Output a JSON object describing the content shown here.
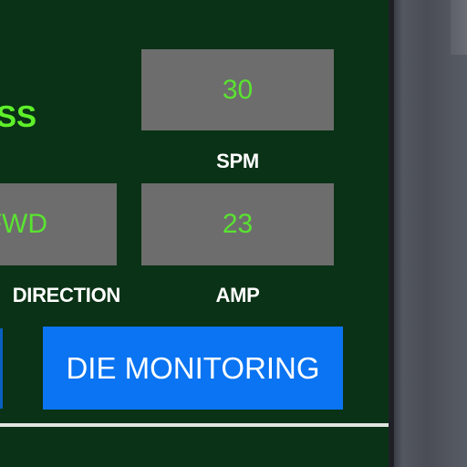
{
  "colors": {
    "panel_background": "#0a3216",
    "value_box": "#6d6d6d",
    "value_text": "#5ae331",
    "status_text": "#5ef02a",
    "label_text": "#ffffff",
    "button": "#0a74f2",
    "bezel": "#4a4d55"
  },
  "status": {
    "text": "SS"
  },
  "spm": {
    "value": "30",
    "label": "SPM"
  },
  "direction": {
    "value": "FWD",
    "label": "DIRECTION"
  },
  "amp": {
    "value": "23",
    "label": "AMP"
  },
  "die_monitoring": {
    "label": "DIE MONITORING"
  }
}
